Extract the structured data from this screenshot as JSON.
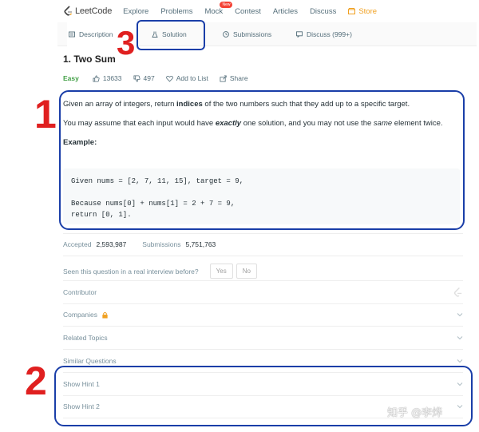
{
  "nav": {
    "logo": "LeetCode",
    "links": [
      "Explore",
      "Problems",
      "Mock",
      "Contest",
      "Articles",
      "Discuss"
    ],
    "store": "Store",
    "new_badge": "New"
  },
  "tabs": {
    "description": "Description",
    "solution": "Solution",
    "submissions": "Submissions",
    "discuss": "Discuss (999+)"
  },
  "question": {
    "title": "1. Two Sum",
    "difficulty": "Easy",
    "likes": "13633",
    "dislikes": "497",
    "add_to_list": "Add to List",
    "share": "Share"
  },
  "description": {
    "p1_before": "Given an array of integers, return ",
    "p1_bold": "indices",
    "p1_after": " of the two numbers such that they add up to a specific target.",
    "p2_before": "You may assume that each input would have ",
    "p2_bold": "exactly",
    "p2_mid": " one solution, and you may not use the ",
    "p2_italic": "same",
    "p2_after": " element twice.",
    "example_label": "Example:",
    "code_line1": "Given nums = [2, 7, 11, 15], target = 9,",
    "code_line2": "",
    "code_line3": "Because nums[0] + nums[1] = 2 + 7 = 9,",
    "code_line4": "return [0, 1]."
  },
  "stats": {
    "accepted_label": "Accepted",
    "accepted_value": "2,593,987",
    "submissions_label": "Submissions",
    "submissions_value": "5,751,763"
  },
  "interview": {
    "question": "Seen this question in a real interview before?",
    "yes": "Yes",
    "no": "No"
  },
  "sections": {
    "contributor": "Contributor",
    "companies": "Companies",
    "related_topics": "Related Topics",
    "similar_questions": "Similar Questions",
    "hint1": "Show Hint 1",
    "hint2": "Show Hint 2"
  },
  "annotations": {
    "n1": "1",
    "n2": "2",
    "n3": "3"
  },
  "watermark": "知乎 @李烨",
  "colors": {
    "accent_annotation_box": "#1a3ea8",
    "annotation_number": "#e02020",
    "easy": "#43a047",
    "store": "#f0a020"
  }
}
